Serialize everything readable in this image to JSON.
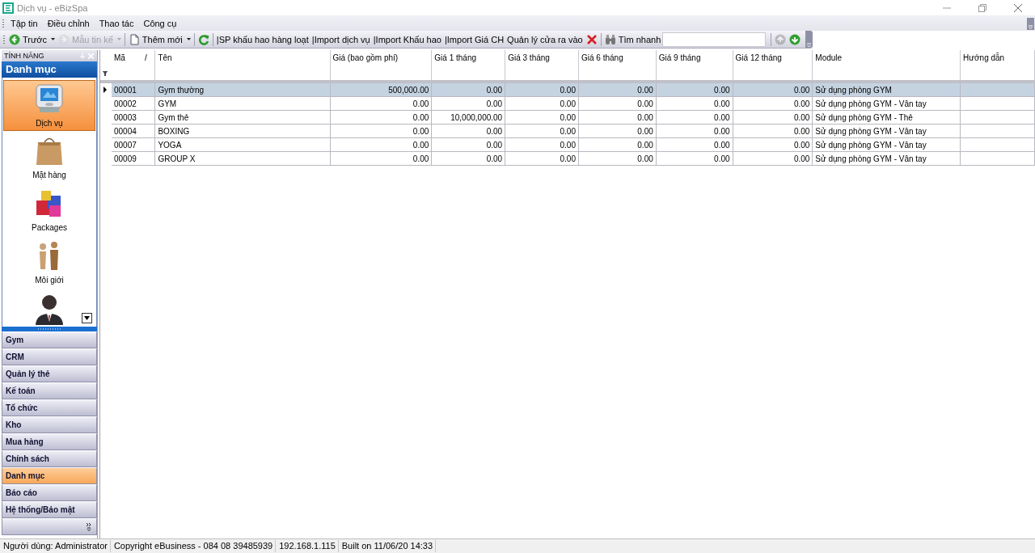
{
  "window": {
    "title": "Dịch vụ - eBizSpa"
  },
  "menu": [
    "Tập tin",
    "Điều chỉnh",
    "Thao tác",
    "Công cụ"
  ],
  "toolbar": [
    {
      "kind": "back",
      "label": "Trước",
      "dropdown": true,
      "disabled": false
    },
    {
      "kind": "next",
      "label": "Mẫu tin kế",
      "dropdown": true,
      "disabled": true
    },
    {
      "kind": "new",
      "label": "Thêm mới",
      "dropdown": true,
      "disabled": false
    },
    {
      "kind": "refresh",
      "dropdown": false,
      "disabled": false
    },
    {
      "kind": "text",
      "label": "|SP khấu hao hàng loạt",
      "dropdown": false,
      "disabled": false
    },
    {
      "kind": "text",
      "label": "|Import dịch vụ",
      "dropdown": false,
      "disabled": false
    },
    {
      "kind": "text",
      "label": "|Import Khấu hao",
      "dropdown": false,
      "disabled": false
    },
    {
      "kind": "text",
      "label": "|Import Giá CH",
      "dropdown": false,
      "disabled": false
    },
    {
      "kind": "text",
      "label": "Quản lý cửa ra vào",
      "dropdown": false,
      "disabled": false
    },
    {
      "kind": "delete",
      "dropdown": false,
      "disabled": false
    },
    {
      "kind": "find",
      "label": "Tìm nhanh",
      "dropdown": false,
      "disabled": false
    },
    {
      "kind": "search"
    },
    {
      "kind": "up",
      "dropdown": false,
      "disabled": true
    },
    {
      "kind": "down",
      "dropdown": false,
      "disabled": false
    }
  ],
  "sidebar": {
    "header": "TÍNH NĂNG",
    "title": "Danh mục",
    "items": [
      {
        "kind": "device",
        "label": "Dịch vụ",
        "selected": true
      },
      {
        "kind": "bag",
        "label": "Mặt hàng",
        "selected": false
      },
      {
        "kind": "boxes",
        "label": "Packages",
        "selected": false
      },
      {
        "kind": "people",
        "label": "Môi giới",
        "selected": false
      },
      {
        "kind": "person",
        "selected": false
      }
    ],
    "groups": [
      {
        "label": "Gym",
        "selected": false
      },
      {
        "label": "CRM",
        "selected": false
      },
      {
        "label": "Quản lý thẻ",
        "selected": false
      },
      {
        "label": "Kế toán",
        "selected": false
      },
      {
        "label": "Tổ chức",
        "selected": false
      },
      {
        "label": "Kho",
        "selected": false
      },
      {
        "label": "Mua hàng",
        "selected": false
      },
      {
        "label": "Chính sách",
        "selected": false
      },
      {
        "label": "Danh mục",
        "selected": true
      },
      {
        "label": "Báo cáo",
        "selected": false
      },
      {
        "label": "Hệ thống/Bảo mật",
        "selected": false
      }
    ]
  },
  "table": {
    "columns": [
      {
        "label": "Mã",
        "kind": "text",
        "sort": "/"
      },
      {
        "label": "Tên",
        "kind": "text"
      },
      {
        "label": "Giá (bao gồm phí)",
        "kind": "number"
      },
      {
        "label": "Giá 1 tháng",
        "kind": "number"
      },
      {
        "label": "Giá 3 tháng",
        "kind": "number"
      },
      {
        "label": "Giá 6 tháng",
        "kind": "number"
      },
      {
        "label": "Giá 9 tháng",
        "kind": "number"
      },
      {
        "label": "Giá 12 tháng",
        "kind": "number"
      },
      {
        "label": "Module",
        "kind": "text"
      },
      {
        "label": "Hướng dẫn",
        "kind": "text"
      }
    ],
    "rows": [
      {
        "selected": true,
        "cells": [
          "00001",
          "Gym thường",
          "500,000.00",
          "0.00",
          "0.00",
          "0.00",
          "0.00",
          "0.00",
          "Sử dụng phòng GYM",
          ""
        ]
      },
      {
        "selected": false,
        "cells": [
          "00002",
          "GYM",
          "0.00",
          "0.00",
          "0.00",
          "0.00",
          "0.00",
          "0.00",
          "Sử dụng phòng GYM - Vân tay",
          ""
        ]
      },
      {
        "selected": false,
        "cells": [
          "00003",
          "Gym thẻ",
          "0.00",
          "10,000,000.00",
          "0.00",
          "0.00",
          "0.00",
          "0.00",
          "Sử dụng phòng GYM - Thẻ",
          ""
        ]
      },
      {
        "selected": false,
        "cells": [
          "00004",
          "BOXING",
          "0.00",
          "0.00",
          "0.00",
          "0.00",
          "0.00",
          "0.00",
          "Sử dụng phòng GYM - Vân tay",
          ""
        ]
      },
      {
        "selected": false,
        "cells": [
          "00007",
          "YOGA",
          "0.00",
          "0.00",
          "0.00",
          "0.00",
          "0.00",
          "0.00",
          "Sử dụng phòng GYM - Vân tay",
          ""
        ]
      },
      {
        "selected": false,
        "cells": [
          "00009",
          "GROUP X",
          "0.00",
          "0.00",
          "0.00",
          "0.00",
          "0.00",
          "0.00",
          "Sử dụng phòng GYM - Vân tay",
          ""
        ]
      }
    ]
  },
  "status_bar": [
    "Người dùng: Administrator",
    "Copyright eBusiness - 084 08 39485939",
    "192.168.1.115",
    "Built on 11/06/20 14:33"
  ]
}
